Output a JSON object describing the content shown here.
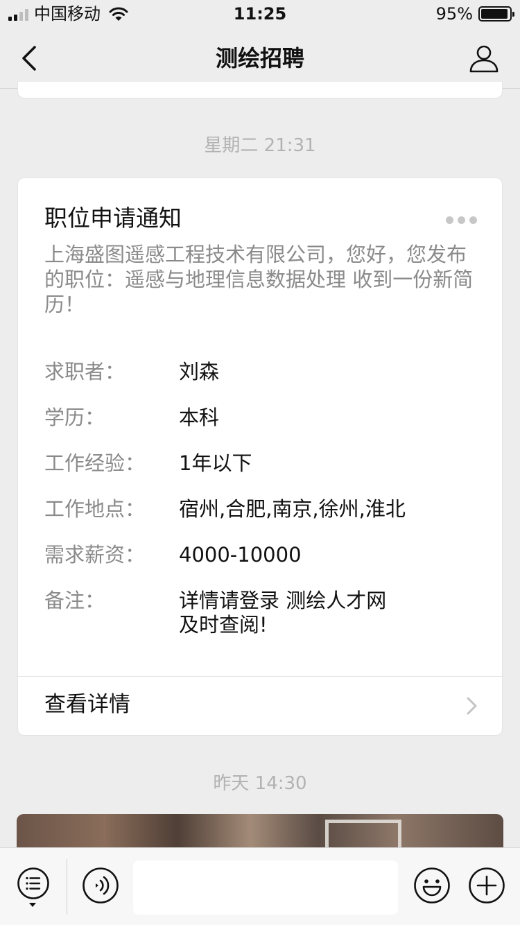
{
  "status_bar": {
    "carrier": "中国移动",
    "time": "11:25",
    "battery": "95%"
  },
  "nav": {
    "title": "测绘招聘"
  },
  "messages": [
    {
      "timestamp": "星期二 21:31",
      "card": {
        "title": "职位申请通知",
        "description": "上海盛图遥感工程技术有限公司，您好，您发布的职位：遥感与地理信息数据处理 收到一份新简历！",
        "fields": [
          {
            "label": "求职者：",
            "value": "刘森"
          },
          {
            "label": "学历：",
            "value": "本科"
          },
          {
            "label": "工作经验：",
            "value": "1年以下"
          },
          {
            "label": "工作地点：",
            "value": "宿州,合肥,南京,徐州,淮北"
          },
          {
            "label": "需求薪资：",
            "value": "4000-10000"
          },
          {
            "label": "备注：",
            "value": "详情请登录 测绘人才网\n及时查阅!"
          }
        ],
        "action_label": "查看详情"
      }
    },
    {
      "timestamp": "昨天 14:30"
    }
  ],
  "toolbar": {
    "input_value": "",
    "input_placeholder": ""
  },
  "icons": {
    "back": "chevron-left-icon",
    "profile": "person-icon",
    "more": "more-dots-icon",
    "detail": "chevron-right-icon",
    "menu": "menu-list-icon",
    "voice": "voice-icon",
    "emoji": "emoji-icon",
    "plus": "plus-icon"
  }
}
